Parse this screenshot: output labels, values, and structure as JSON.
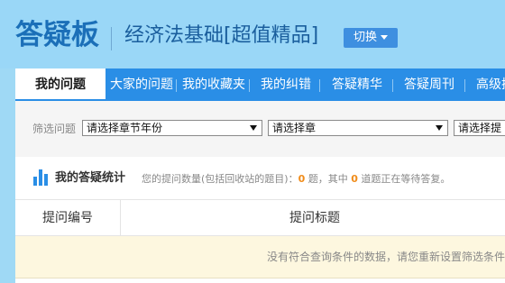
{
  "header": {
    "logo": "答疑板",
    "course_title": "经济法基础[超值精品]",
    "switch_label": "切换"
  },
  "nav": {
    "items": [
      {
        "label": "我的问题",
        "active": true
      },
      {
        "label": "大家的问题",
        "active": false
      },
      {
        "label": "我的收藏夹",
        "active": false
      },
      {
        "label": "我的纠错",
        "active": false
      },
      {
        "label": "答疑精华",
        "active": false
      },
      {
        "label": "答疑周刊",
        "active": false
      },
      {
        "label": "高级搜",
        "active": false
      }
    ]
  },
  "filter": {
    "label": "筛选问题",
    "select_year": "请选择章节年份",
    "select_chapter": "请选择章",
    "select_third": "请选择提"
  },
  "stats": {
    "title": "我的答疑统计",
    "prefix": "您的提问数量(包括回收站的题目)：",
    "count": "0",
    "middle": " 题，其中 ",
    "waiting": "0",
    "suffix": " 道题正在等待答复。"
  },
  "table": {
    "col_id": "提问编号",
    "col_title": "提问标题",
    "empty_message": "没有符合查询条件的数据，请您重新设置筛选条件"
  },
  "colors": {
    "header_bg": "#9ad7f7",
    "nav_bg": "#2a8ee6",
    "accent_orange": "#f08c1a",
    "empty_row_bg": "#fdf7df"
  }
}
